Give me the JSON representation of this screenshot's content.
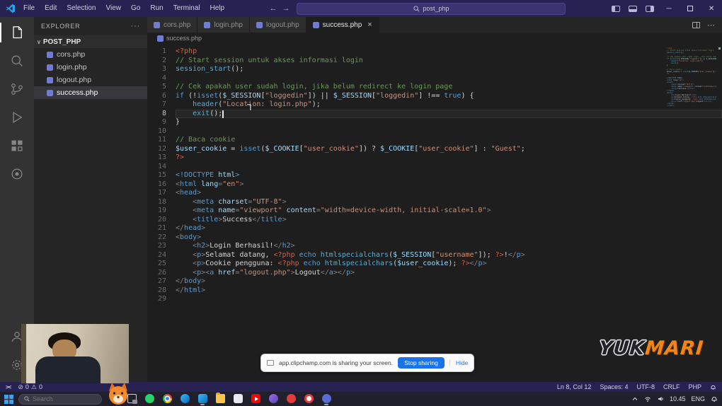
{
  "titlebar": {
    "menus": [
      "File",
      "Edit",
      "Selection",
      "View",
      "Go",
      "Run",
      "Terminal",
      "Help"
    ],
    "search_text": "post_php",
    "back_arrow": "←",
    "forward_arrow": "→",
    "minimize_label": "─",
    "close_label": "✕"
  },
  "icons": {
    "activity": [
      "explorer-icon",
      "search-icon",
      "source-control-icon",
      "run-debug-icon",
      "extensions-icon",
      "plugin-icon",
      "account-icon",
      "settings-gear-icon"
    ],
    "titlebar": [
      "vscode-logo",
      "panel-left-icon",
      "panel-bottom-icon",
      "panel-right-icon"
    ],
    "taskbar": [
      "windows-start-icon",
      "search-icon",
      "task-view-icon",
      "tray-chevron-icon",
      "wifi-icon",
      "speaker-icon",
      "notification-bell-icon"
    ]
  },
  "explorer": {
    "header": "EXPLORER",
    "more_actions": "···",
    "section_chevron": "∨",
    "section": "POST_PHP",
    "files": [
      {
        "name": "cors.php",
        "active": false
      },
      {
        "name": "login.php",
        "active": false
      },
      {
        "name": "logout.php",
        "active": false
      },
      {
        "name": "success.php",
        "active": true
      }
    ]
  },
  "tabs": [
    {
      "label": "cors.php",
      "active": false
    },
    {
      "label": "login.php",
      "active": false
    },
    {
      "label": "logout.php",
      "active": false
    },
    {
      "label": "success.php",
      "active": true,
      "close": "×"
    }
  ],
  "breadcrumb": "success.php",
  "editor": {
    "active_line": 8,
    "cursor_col": 12,
    "lines": [
      [
        [
          "pt",
          "<?php"
        ]
      ],
      [
        [
          "cm",
          "// Start session untuk akses informasi login"
        ]
      ],
      [
        [
          "fn",
          "session_start"
        ],
        [
          "pl",
          "();"
        ]
      ],
      [],
      [
        [
          "cm",
          "// Cek apakah user sudah login, jika belum redirect ke login page"
        ]
      ],
      [
        [
          "kw",
          "if"
        ],
        [
          "pl",
          " (!"
        ],
        [
          "kw",
          "isset"
        ],
        [
          "pl",
          "("
        ],
        [
          "vr",
          "$_SESSION"
        ],
        [
          "pl",
          "["
        ],
        [
          "st",
          "\"loggedin\""
        ],
        [
          "pl",
          "]) || "
        ],
        [
          "vr",
          "$_SESSION"
        ],
        [
          "pl",
          "["
        ],
        [
          "st",
          "\"loggedin\""
        ],
        [
          "pl",
          "] !== "
        ],
        [
          "kw",
          "true"
        ],
        [
          "pl",
          ") {"
        ]
      ],
      [
        [
          "pl",
          "    "
        ],
        [
          "fn",
          "header"
        ],
        [
          "pl",
          "("
        ],
        [
          "st",
          "\"Location: login.php\""
        ],
        [
          "pl",
          ");"
        ]
      ],
      [
        [
          "pl",
          "    "
        ],
        [
          "fn",
          "exit"
        ],
        [
          "pl",
          "();"
        ]
      ],
      [
        [
          "pl",
          "}"
        ]
      ],
      [],
      [
        [
          "cm",
          "// Baca cookie"
        ]
      ],
      [
        [
          "vr",
          "$user_cookie"
        ],
        [
          "pl",
          " = "
        ],
        [
          "kw",
          "isset"
        ],
        [
          "pl",
          "("
        ],
        [
          "vr",
          "$_COOKIE"
        ],
        [
          "pl",
          "["
        ],
        [
          "st",
          "\"user_cookie\""
        ],
        [
          "pl",
          "]) ? "
        ],
        [
          "vr",
          "$_COOKIE"
        ],
        [
          "pl",
          "["
        ],
        [
          "st",
          "\"user_cookie\""
        ],
        [
          "pl",
          "] : "
        ],
        [
          "st",
          "\"Guest\""
        ],
        [
          "pl",
          ";"
        ]
      ],
      [
        [
          "pt",
          "?>"
        ]
      ],
      [],
      [
        [
          "tg",
          "<!DOCTYPE"
        ],
        [
          "at",
          " html"
        ],
        [
          "tg",
          ">"
        ]
      ],
      [
        [
          "pu",
          "<"
        ],
        [
          "tg",
          "html"
        ],
        [
          "at",
          " lang"
        ],
        [
          "pu",
          "="
        ],
        [
          "st",
          "\"en\""
        ],
        [
          "pu",
          ">"
        ]
      ],
      [
        [
          "pu",
          "<"
        ],
        [
          "tg",
          "head"
        ],
        [
          "pu",
          ">"
        ]
      ],
      [
        [
          "pl",
          "    "
        ],
        [
          "pu",
          "<"
        ],
        [
          "tg",
          "meta"
        ],
        [
          "at",
          " charset"
        ],
        [
          "pu",
          "="
        ],
        [
          "st",
          "\"UTF-8\""
        ],
        [
          "pu",
          ">"
        ]
      ],
      [
        [
          "pl",
          "    "
        ],
        [
          "pu",
          "<"
        ],
        [
          "tg",
          "meta"
        ],
        [
          "at",
          " name"
        ],
        [
          "pu",
          "="
        ],
        [
          "st",
          "\"viewport\""
        ],
        [
          "at",
          " content"
        ],
        [
          "pu",
          "="
        ],
        [
          "st",
          "\"width=device-width, initial-scale=1.0\""
        ],
        [
          "pu",
          ">"
        ]
      ],
      [
        [
          "pl",
          "    "
        ],
        [
          "pu",
          "<"
        ],
        [
          "tg",
          "title"
        ],
        [
          "pu",
          ">"
        ],
        [
          "pl",
          "Success"
        ],
        [
          "pu",
          "</"
        ],
        [
          "tg",
          "title"
        ],
        [
          "pu",
          ">"
        ]
      ],
      [
        [
          "pu",
          "</"
        ],
        [
          "tg",
          "head"
        ],
        [
          "pu",
          ">"
        ]
      ],
      [
        [
          "pu",
          "<"
        ],
        [
          "tg",
          "body"
        ],
        [
          "pu",
          ">"
        ]
      ],
      [
        [
          "pl",
          "    "
        ],
        [
          "pu",
          "<"
        ],
        [
          "tg",
          "h2"
        ],
        [
          "pu",
          ">"
        ],
        [
          "pl",
          "Login Berhasil!"
        ],
        [
          "pu",
          "</"
        ],
        [
          "tg",
          "h2"
        ],
        [
          "pu",
          ">"
        ]
      ],
      [
        [
          "pl",
          "    "
        ],
        [
          "pu",
          "<"
        ],
        [
          "tg",
          "p"
        ],
        [
          "pu",
          ">"
        ],
        [
          "pl",
          "Selamat datang, "
        ],
        [
          "pt",
          "<?php "
        ],
        [
          "kw",
          "echo "
        ],
        [
          "fn",
          "htmlspecialchars"
        ],
        [
          "pl",
          "("
        ],
        [
          "vr",
          "$_SESSION"
        ],
        [
          "pl",
          "["
        ],
        [
          "st",
          "\"username\""
        ],
        [
          "pl",
          "]); "
        ],
        [
          "pt",
          "?>"
        ],
        [
          "pl",
          "!"
        ],
        [
          "pu",
          "</"
        ],
        [
          "tg",
          "p"
        ],
        [
          "pu",
          ">"
        ]
      ],
      [
        [
          "pl",
          "    "
        ],
        [
          "pu",
          "<"
        ],
        [
          "tg",
          "p"
        ],
        [
          "pu",
          ">"
        ],
        [
          "pl",
          "Cookie pengguna: "
        ],
        [
          "pt",
          "<?php "
        ],
        [
          "kw",
          "echo "
        ],
        [
          "fn",
          "htmlspecialchars"
        ],
        [
          "pl",
          "("
        ],
        [
          "vr",
          "$user_cookie"
        ],
        [
          "pl",
          "); "
        ],
        [
          "pt",
          "?>"
        ],
        [
          "pu",
          "</"
        ],
        [
          "tg",
          "p"
        ],
        [
          "pu",
          ">"
        ]
      ],
      [
        [
          "pl",
          "    "
        ],
        [
          "pu",
          "<"
        ],
        [
          "tg",
          "p"
        ],
        [
          "pu",
          ">"
        ],
        [
          "pu",
          "<"
        ],
        [
          "tg",
          "a"
        ],
        [
          "at",
          " href"
        ],
        [
          "pu",
          "="
        ],
        [
          "st",
          "\"logout.php\""
        ],
        [
          "pu",
          ">"
        ],
        [
          "pl",
          "Logout"
        ],
        [
          "pu",
          "</"
        ],
        [
          "tg",
          "a"
        ],
        [
          "pu",
          ">"
        ],
        [
          "pu",
          "</"
        ],
        [
          "tg",
          "p"
        ],
        [
          "pu",
          ">"
        ]
      ],
      [
        [
          "pu",
          "</"
        ],
        [
          "tg",
          "body"
        ],
        [
          "pu",
          ">"
        ]
      ],
      [
        [
          "pu",
          "</"
        ],
        [
          "tg",
          "html"
        ],
        [
          "pu",
          ">"
        ]
      ],
      []
    ]
  },
  "status_bar": {
    "remote": "><",
    "error_icon": "⊘",
    "errors": "0",
    "warning_icon": "⚠",
    "warnings": "0",
    "cursor": "Ln 8, Col 12",
    "indent": "Spaces: 4",
    "encoding": "UTF-8",
    "eol": "CRLF",
    "language": "PHP"
  },
  "sharing_bar": {
    "message": "app.clipchamp.com is sharing your screen.",
    "stop_label": "Stop sharing",
    "hide_label": "Hide"
  },
  "watermark": {
    "part_outline": "YUK",
    "part_solid": "MARI"
  },
  "taskbar": {
    "search_placeholder": "Search",
    "tray_time": "10.45",
    "tray_lang": "ENG",
    "apps": [
      {
        "name": "task-view",
        "kind": "taskview",
        "color": ""
      },
      {
        "name": "whatsapp",
        "kind": "circle",
        "color": "#25d366"
      },
      {
        "name": "chrome",
        "kind": "chrome",
        "color": ""
      },
      {
        "name": "edge",
        "kind": "circle",
        "color": "#2f7fd4"
      },
      {
        "name": "vscode",
        "kind": "square",
        "color": "#2aa3e8",
        "running": true
      },
      {
        "name": "file-explorer",
        "kind": "folder",
        "color": ""
      },
      {
        "name": "photos",
        "kind": "square",
        "color": "#e8e8ee"
      },
      {
        "name": "youtube",
        "kind": "youtube",
        "color": ""
      },
      {
        "name": "purple-app",
        "kind": "circle",
        "color": "#7b5cd6"
      },
      {
        "name": "recorder",
        "kind": "circle",
        "color": "#e23b3b"
      },
      {
        "name": "opera",
        "kind": "ring",
        "color": ""
      },
      {
        "name": "clipchamp",
        "kind": "circle",
        "color": "#5a6bd8",
        "running": true
      }
    ]
  },
  "colors": {
    "titlebar_bg": "#282253",
    "editor_bg": "#1e1e1e",
    "sidebar_bg": "#252526",
    "accent_orange": "#f0861a",
    "share_button_blue": "#1a73e8"
  }
}
